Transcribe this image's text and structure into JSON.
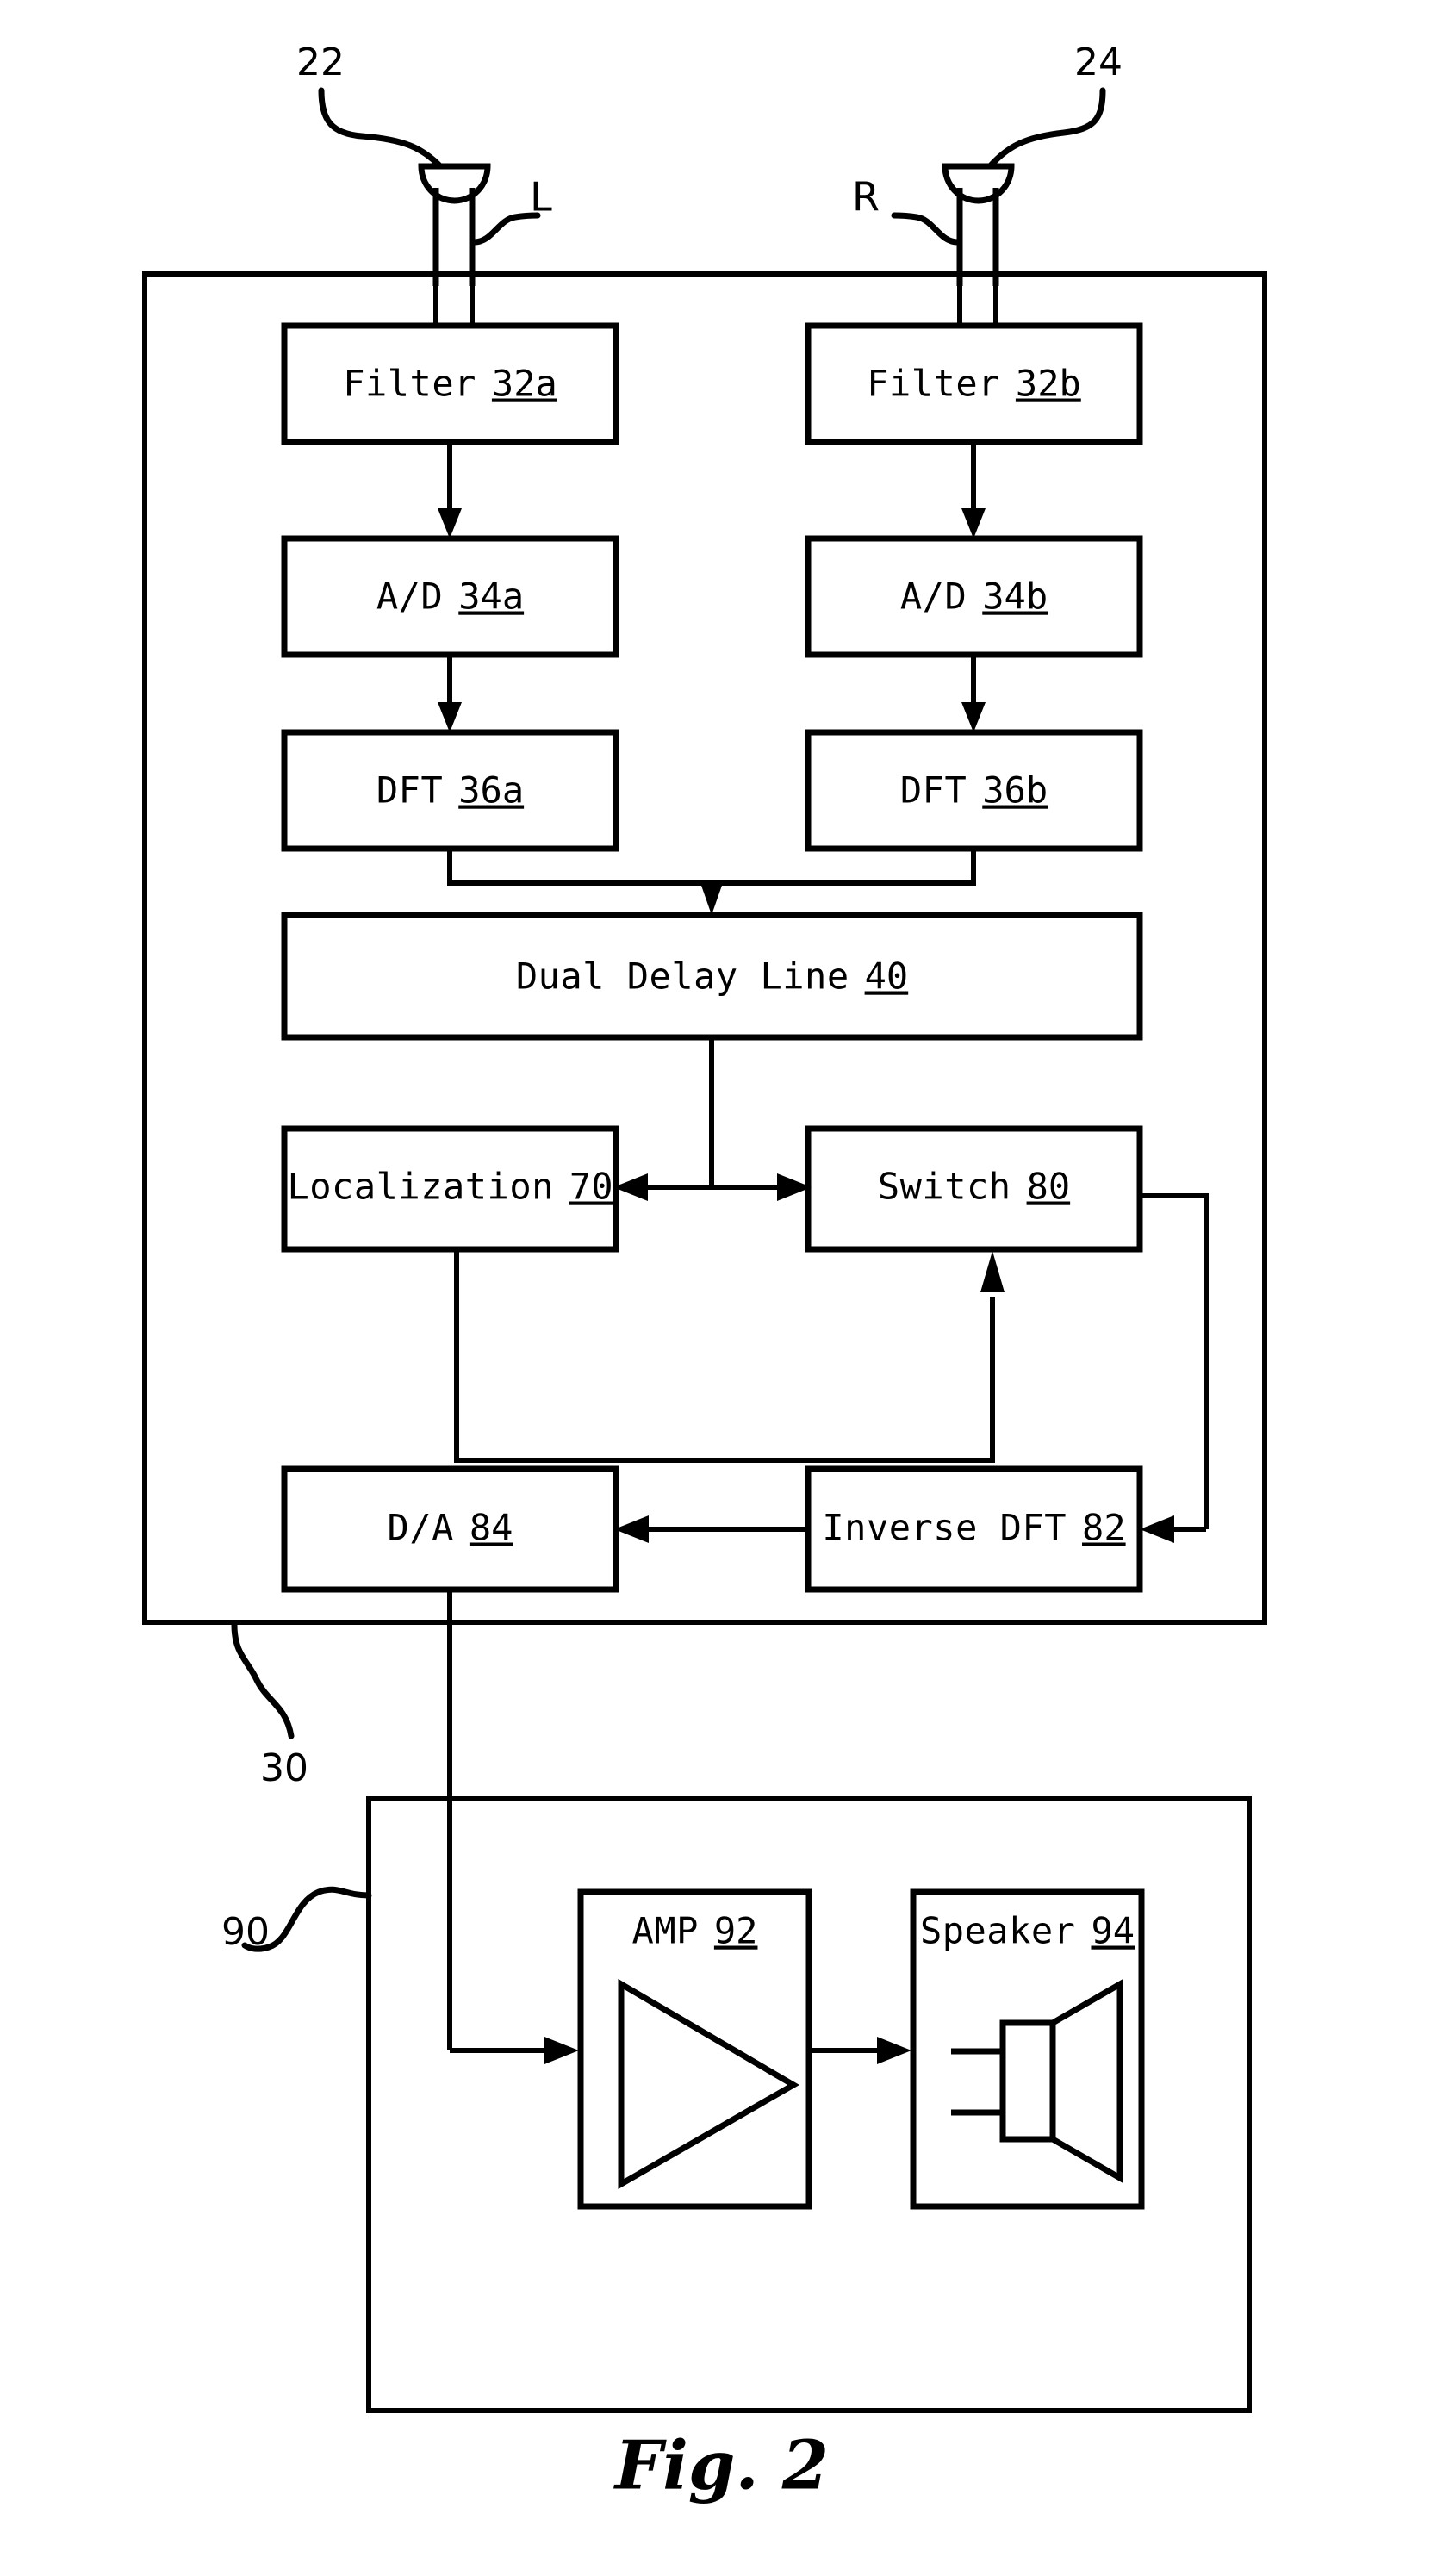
{
  "figure": {
    "caption": "Fig. 2",
    "reference_numerals": {
      "left_mic": "22",
      "right_mic": "24",
      "processor_unit": "30",
      "output_unit": "90"
    },
    "channel_labels": {
      "left": "L",
      "right": "R"
    }
  },
  "blocks": {
    "filter_a": {
      "name": "Filter",
      "num": "32a"
    },
    "filter_b": {
      "name": "Filter",
      "num": "32b"
    },
    "ad_a": {
      "name": "A/D",
      "num": "34a"
    },
    "ad_b": {
      "name": "A/D",
      "num": "34b"
    },
    "dft_a": {
      "name": "DFT",
      "num": "36a"
    },
    "dft_b": {
      "name": "DFT",
      "num": "36b"
    },
    "dual_delay_line": {
      "name": "Dual Delay Line",
      "num": "40"
    },
    "localization": {
      "name": "Localization",
      "num": "70"
    },
    "switch": {
      "name": "Switch",
      "num": "80"
    },
    "inverse_dft": {
      "name": "Inverse DFT",
      "num": "82"
    },
    "da": {
      "name": "D/A",
      "num": "84"
    },
    "amp": {
      "name": "AMP",
      "num": "92"
    },
    "speaker": {
      "name": "Speaker",
      "num": "94"
    }
  },
  "icons": {
    "left_microphone": "microphone-icon",
    "right_microphone": "microphone-icon",
    "amplifier": "amplifier-triangle-icon",
    "loudspeaker": "loudspeaker-icon"
  }
}
